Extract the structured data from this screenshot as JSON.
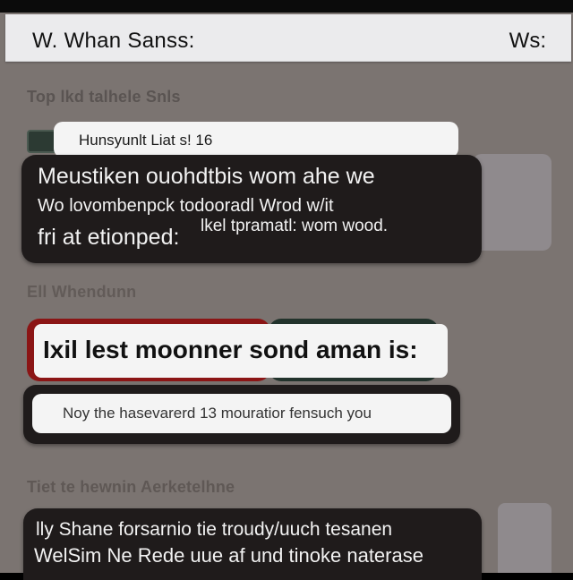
{
  "header": {
    "title": "W. Whan Sanss:",
    "right_label": "Ws:"
  },
  "section1": {
    "label": "Top lkd talhele Snls",
    "pill_text": "Hunsyunlt Liat s! 16",
    "bubble": {
      "line1": "Meustiken ouohdtbis wom ahe we",
      "line2": "Wo lovombenpck todooradl Wrod w/it",
      "line3": "fri at etionped:",
      "line4": "lkel tpramatl: wom wood."
    }
  },
  "section2": {
    "label": "Ell Whendunn",
    "input_text": "Ixil lest moonner sond aman is:",
    "info_text": "Noy the hasevarerd 13 mouratior fensuch you"
  },
  "section3": {
    "label": "Tiet te hewnin Aerketelhne",
    "bubble": {
      "line1": "lly Shane forsarnio tie troudy/uuch tesanen",
      "line2": "WelSim Ne Rede uue af und tinoke naterase"
    }
  }
}
